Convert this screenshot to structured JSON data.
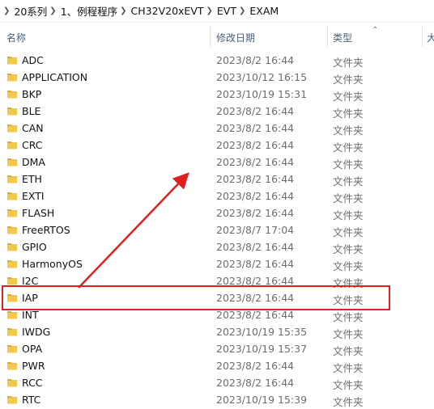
{
  "breadcrumb": [
    "20系列",
    "1、例程程序",
    "CH32V20xEVT",
    "EVT",
    "EXAM"
  ],
  "columns": {
    "name": "名称",
    "modified": "修改日期",
    "type": "类型",
    "size": "大"
  },
  "files": [
    {
      "name": "ADC",
      "modified": "2023/8/2 16:44",
      "type": "文件夹"
    },
    {
      "name": "APPLICATION",
      "modified": "2023/10/12 16:15",
      "type": "文件夹"
    },
    {
      "name": "BKP",
      "modified": "2023/10/19 15:31",
      "type": "文件夹"
    },
    {
      "name": "BLE",
      "modified": "2023/8/2 16:44",
      "type": "文件夹"
    },
    {
      "name": "CAN",
      "modified": "2023/8/2 16:44",
      "type": "文件夹"
    },
    {
      "name": "CRC",
      "modified": "2023/8/2 16:44",
      "type": "文件夹"
    },
    {
      "name": "DMA",
      "modified": "2023/8/2 16:44",
      "type": "文件夹"
    },
    {
      "name": "ETH",
      "modified": "2023/8/2 16:44",
      "type": "文件夹"
    },
    {
      "name": "EXTI",
      "modified": "2023/8/2 16:44",
      "type": "文件夹"
    },
    {
      "name": "FLASH",
      "modified": "2023/8/2 16:44",
      "type": "文件夹"
    },
    {
      "name": "FreeRTOS",
      "modified": "2023/8/7 17:04",
      "type": "文件夹"
    },
    {
      "name": "GPIO",
      "modified": "2023/8/2 16:44",
      "type": "文件夹"
    },
    {
      "name": "HarmonyOS",
      "modified": "2023/8/2 16:44",
      "type": "文件夹"
    },
    {
      "name": "I2C",
      "modified": "2023/8/2 16:44",
      "type": "文件夹"
    },
    {
      "name": "IAP",
      "modified": "2023/8/2 16:44",
      "type": "文件夹",
      "highlighted": true
    },
    {
      "name": "INT",
      "modified": "2023/8/2 16:44",
      "type": "文件夹"
    },
    {
      "name": "IWDG",
      "modified": "2023/10/19 15:35",
      "type": "文件夹"
    },
    {
      "name": "OPA",
      "modified": "2023/10/19 15:37",
      "type": "文件夹"
    },
    {
      "name": "PWR",
      "modified": "2023/8/2 16:44",
      "type": "文件夹"
    },
    {
      "name": "RCC",
      "modified": "2023/8/2 16:44",
      "type": "文件夹"
    },
    {
      "name": "RTC",
      "modified": "2023/10/19 15:39",
      "type": "文件夹"
    }
  ],
  "icons": {
    "folder": "folder-icon",
    "breadcrumb_separator": "chevron-right-icon",
    "sort": "chevron-up-icon"
  },
  "colors": {
    "folder": "#f2c94c",
    "folder_dark": "#dcab2f",
    "annotation": "#e02020",
    "header_text": "#4c607a",
    "meta_text": "#6d6d6d"
  }
}
